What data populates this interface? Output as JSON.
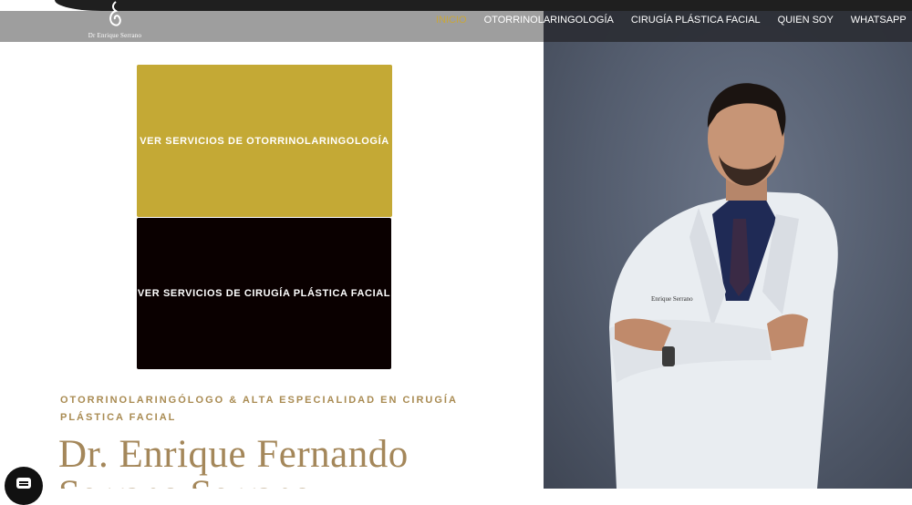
{
  "header": {
    "logo_text": "Dr Enrique Serrano",
    "nav": [
      {
        "label": "INICIO",
        "active": true
      },
      {
        "label": "OTORRINOLARINGOLOGÍA",
        "active": false
      },
      {
        "label": "CIRUGÍA PLÁSTICA FACIAL",
        "active": false
      },
      {
        "label": "QUIEN SOY",
        "active": false
      },
      {
        "label": "WHATSAPP",
        "active": false
      }
    ]
  },
  "services": {
    "otorrino_button": "VER SERVICIOS DE OTORRINOLARINGOLOGÍA",
    "cirugia_button": "VER SERVICIOS DE CIRUGÍA PLÁSTICA FACIAL"
  },
  "hero": {
    "subtitle": "OTORRINOLARINGÓLOGO & ALTA ESPECIALIDAD EN CIRUGÍA PLÁSTICA FACIAL",
    "name_line1": "Dr. Enrique Fernando",
    "name_line2": "Serrano Serrano"
  },
  "colors": {
    "accent_gold": "#c4a935",
    "nav_active": "#c9a73a",
    "title_color": "#a4875a",
    "dark_block": "#0a0000"
  },
  "icons": {
    "logo": "logo-mark-icon",
    "chat": "chat-icon"
  }
}
